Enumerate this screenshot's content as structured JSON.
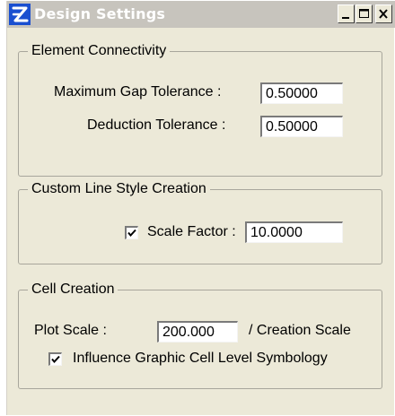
{
  "window": {
    "title": "Design Settings",
    "icon": "microstation-logo-icon",
    "controls": [
      "minimize-icon",
      "maximize-icon",
      "close-icon"
    ]
  },
  "element_connectivity": {
    "legend": "Element Connectivity",
    "max_gap_label": "Maximum Gap Tolerance :",
    "max_gap_value": "0.50000",
    "deduction_label": "Deduction Tolerance :",
    "deduction_value": "0.50000"
  },
  "custom_line_style": {
    "legend": "Custom Line Style Creation",
    "scale_factor_checked": true,
    "scale_factor_label": "Scale Factor :",
    "scale_factor_value": "10.0000"
  },
  "cell_creation": {
    "legend": "Cell Creation",
    "plot_scale_label": "Plot Scale :",
    "plot_scale_value": "200.000",
    "creation_scale_label": "/ Creation Scale",
    "influence_checked": true,
    "influence_label": "Influence Graphic Cell Level Symbology"
  }
}
